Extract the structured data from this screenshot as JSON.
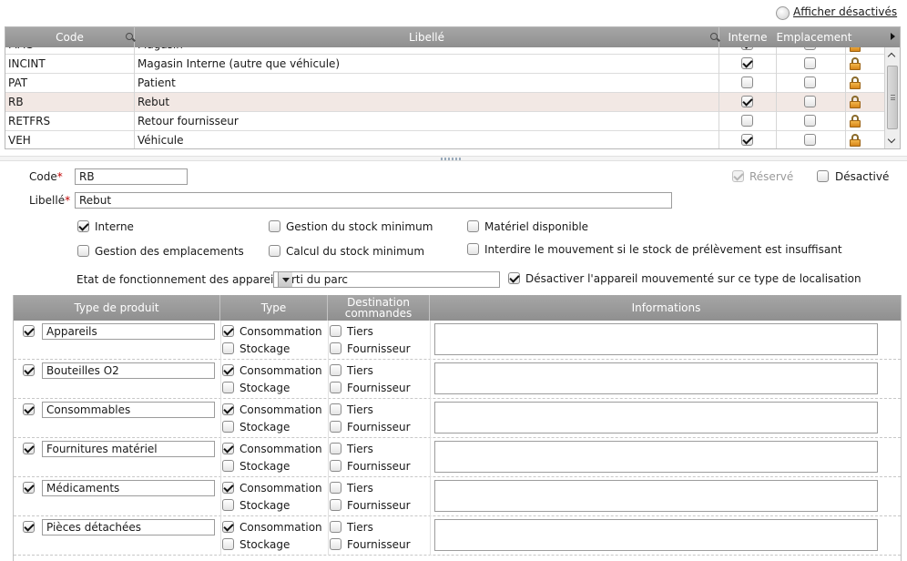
{
  "top_link": {
    "label": "Afficher désactivés"
  },
  "grid": {
    "columns": {
      "code": "Code",
      "libelle": "Libellé",
      "interne": "Interne",
      "emplacement": "Emplacement"
    },
    "partial_row": {
      "code": "MAG",
      "libelle": "Magasin"
    },
    "rows": [
      {
        "code": "INCINT",
        "libelle": "Magasin Interne (autre que véhicule)",
        "interne": true,
        "emplacement": false,
        "selected": false
      },
      {
        "code": "PAT",
        "libelle": "Patient",
        "interne": false,
        "emplacement": false,
        "selected": false
      },
      {
        "code": "RB",
        "libelle": "Rebut",
        "interne": true,
        "emplacement": false,
        "selected": true
      },
      {
        "code": "RETFRS",
        "libelle": "Retour fournisseur",
        "interne": false,
        "emplacement": false,
        "selected": false
      },
      {
        "code": "VEH",
        "libelle": "Véhicule",
        "interne": true,
        "emplacement": false,
        "selected": false
      }
    ]
  },
  "form": {
    "code_label": "Code",
    "code_value": "RB",
    "libelle_label": "Libellé",
    "libelle_value": "Rebut",
    "required_mark": "*",
    "reserve_label": "Réservé",
    "reserve_checked": true,
    "desactive_label": "Désactivé",
    "desactive_checked": false,
    "options": {
      "interne": {
        "label": "Interne",
        "checked": true
      },
      "gestion_emplacements": {
        "label": "Gestion des emplacements",
        "checked": false
      },
      "gestion_stock_min": {
        "label": "Gestion du stock minimum",
        "checked": false
      },
      "calcul_stock_min": {
        "label": "Calcul du stock minimum",
        "checked": false
      },
      "materiel_disponible": {
        "label": "Matériel disponible",
        "checked": false
      },
      "interdire_mouvement": {
        "label": "Interdire le mouvement si le stock de prélèvement est insuffisant",
        "checked": false
      }
    },
    "etat_label": "Etat de fonctionnement des appareils",
    "etat_value": "Sorti du parc",
    "desactiver_appareil_label": "Désactiver l'appareil mouvementé sur ce type de localisation",
    "desactiver_appareil_checked": true
  },
  "products": {
    "headers": {
      "type_produit": "Type de produit",
      "type": "Type",
      "destination_1": "Destination",
      "destination_2": "commandes",
      "informations": "Informations"
    },
    "labels": {
      "consommation": "Consommation",
      "stockage": "Stockage",
      "tiers": "Tiers",
      "fournisseur": "Fournisseur"
    },
    "rows": [
      {
        "name": "Appareils",
        "enabled": true,
        "consommation": true,
        "stockage": false,
        "tiers": false,
        "fournisseur": false,
        "info": ""
      },
      {
        "name": "Bouteilles O2",
        "enabled": true,
        "consommation": true,
        "stockage": false,
        "tiers": false,
        "fournisseur": false,
        "info": ""
      },
      {
        "name": "Consommables",
        "enabled": true,
        "consommation": true,
        "stockage": false,
        "tiers": false,
        "fournisseur": false,
        "info": ""
      },
      {
        "name": "Fournitures matériel",
        "enabled": true,
        "consommation": true,
        "stockage": false,
        "tiers": false,
        "fournisseur": false,
        "info": ""
      },
      {
        "name": "Médicaments",
        "enabled": true,
        "consommation": true,
        "stockage": false,
        "tiers": false,
        "fournisseur": false,
        "info": ""
      },
      {
        "name": "Pièces détachées",
        "enabled": true,
        "consommation": true,
        "stockage": false,
        "tiers": false,
        "fournisseur": false,
        "info": ""
      }
    ]
  }
}
